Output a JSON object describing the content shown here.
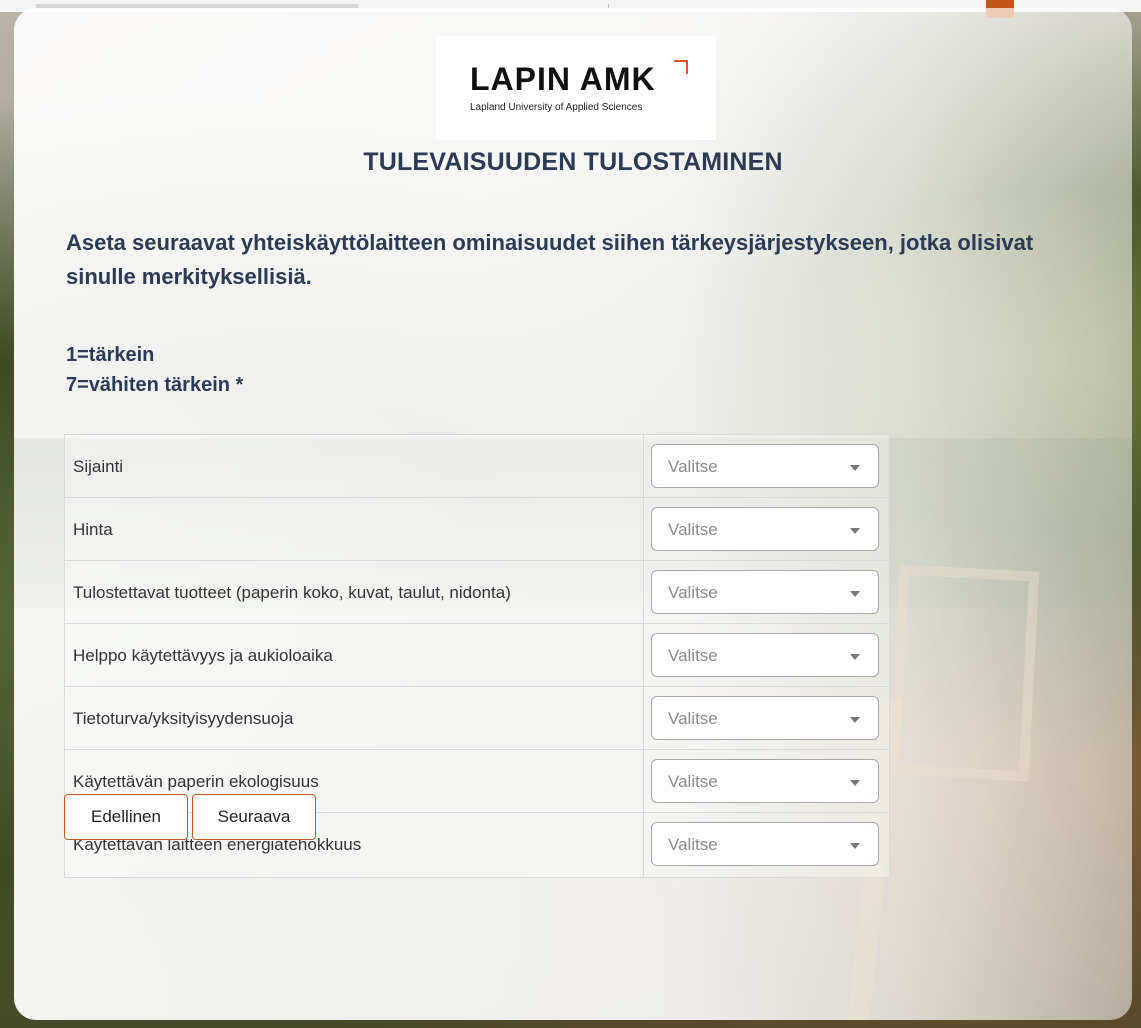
{
  "logo": {
    "wordmark": "LAPIN AMK",
    "tagline": "Lapland University of Applied Sciences",
    "accent_color": "#e3502b"
  },
  "page": {
    "title": "TULEVAISUUDEN TULOSTAMINEN",
    "question": "Aseta seuraavat yhteiskäyttölaitteen ominaisuudet siihen tärkeysjärjestykseen, jotka olisivat sinulle merkityksellisiä.",
    "scale_top": "1=tärkein",
    "scale_bottom": "7=vähiten tärkein *"
  },
  "rows": [
    {
      "label": "Sijainti",
      "selected": "Valitse"
    },
    {
      "label": "Hinta",
      "selected": "Valitse"
    },
    {
      "label": "Tulostettavat tuotteet (paperin koko, kuvat, taulut, nidonta)",
      "selected": "Valitse"
    },
    {
      "label": "Helppo käytettävyys ja aukioloaika",
      "selected": "Valitse"
    },
    {
      "label": "Tietoturva/yksityisyydensuoja",
      "selected": "Valitse"
    },
    {
      "label": "Käytettävän paperin ekologisuus",
      "selected": "Valitse"
    },
    {
      "label": "Käytettävän laitteen energiatehokkuus",
      "selected": "Valitse"
    }
  ],
  "buttons": {
    "prev": "Edellinen",
    "next": "Seuraava"
  },
  "colors": {
    "heading": "#2c3a55",
    "button_border": "#c05a1e"
  }
}
